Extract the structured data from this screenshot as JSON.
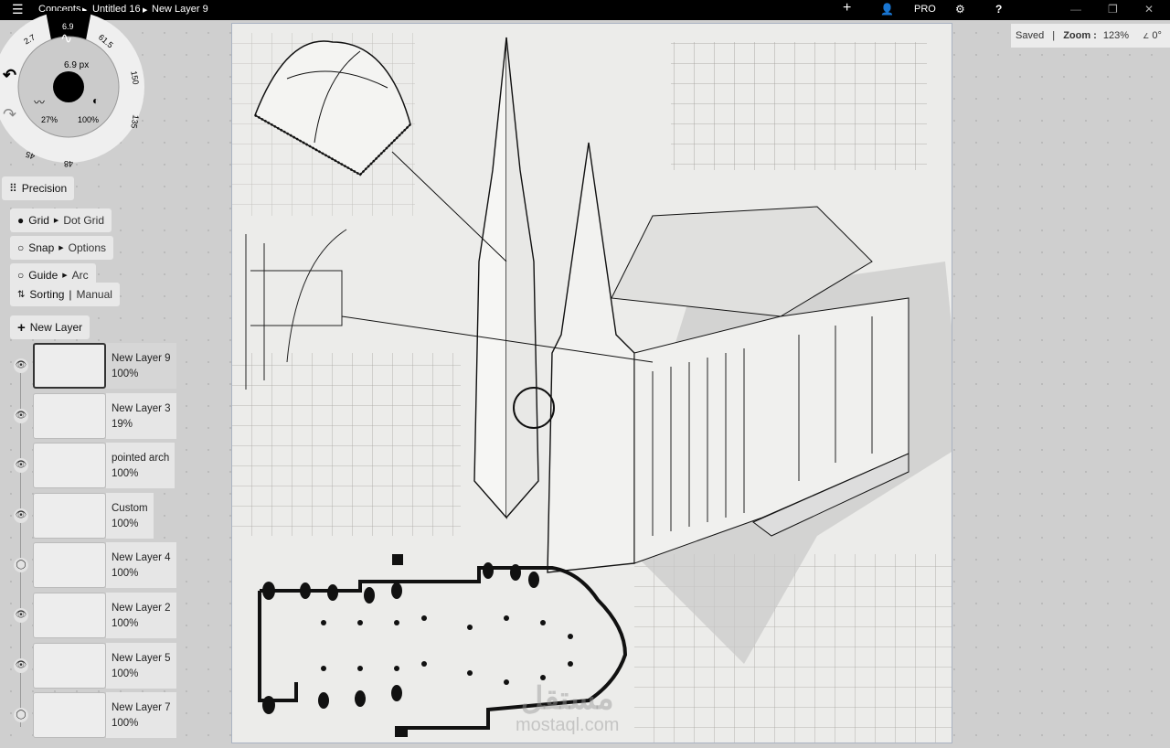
{
  "topbar": {
    "breadcrumbs": [
      "Concepts",
      "Untitled 16",
      "New Layer 9"
    ],
    "pro_label": "PRO",
    "icons": [
      "menu-icon",
      "plus-icon",
      "user-icon",
      "gear-icon",
      "help-icon",
      "minimize-icon",
      "restore-icon",
      "close-icon"
    ],
    "help_label": "?"
  },
  "status": {
    "saved": "Saved",
    "separator": "|",
    "zoom_label": "Zoom :",
    "zoom_value": "123%",
    "rotation": "0°"
  },
  "wheel": {
    "top_size": "6.9",
    "left_size": "2.7",
    "right_values": [
      "61.5",
      "150",
      "135"
    ],
    "bottom_values": [
      "45",
      "48"
    ],
    "stroke_size": "6.9 px",
    "smoothing": "27%",
    "opacity": "100%"
  },
  "precision": {
    "label": "Precision",
    "grid": {
      "label": "Grid",
      "value": "Dot Grid"
    },
    "snap": {
      "label": "Snap",
      "value": "Options"
    },
    "guide": {
      "label": "Guide",
      "value": "Arc"
    },
    "sorting": {
      "label": "Sorting",
      "value": "Manual"
    },
    "new_layer": "New Layer"
  },
  "layers": [
    {
      "name": "New Layer 9",
      "opacity": "100%",
      "visible": true,
      "selected": true
    },
    {
      "name": "New Layer 3",
      "opacity": "19%",
      "visible": true
    },
    {
      "name": "pointed arch",
      "opacity": "100%",
      "visible": true
    },
    {
      "name": "Custom",
      "opacity": "100%",
      "visible": true
    },
    {
      "name": "New Layer 4",
      "opacity": "100%",
      "visible": false
    },
    {
      "name": "New Layer 2",
      "opacity": "100%",
      "visible": true
    },
    {
      "name": "New Layer 5",
      "opacity": "100%",
      "visible": true
    },
    {
      "name": "New Layer 7",
      "opacity": "100%",
      "visible": false
    }
  ],
  "watermark": {
    "arabic": "مستقل",
    "latin": "mostaql.com"
  }
}
